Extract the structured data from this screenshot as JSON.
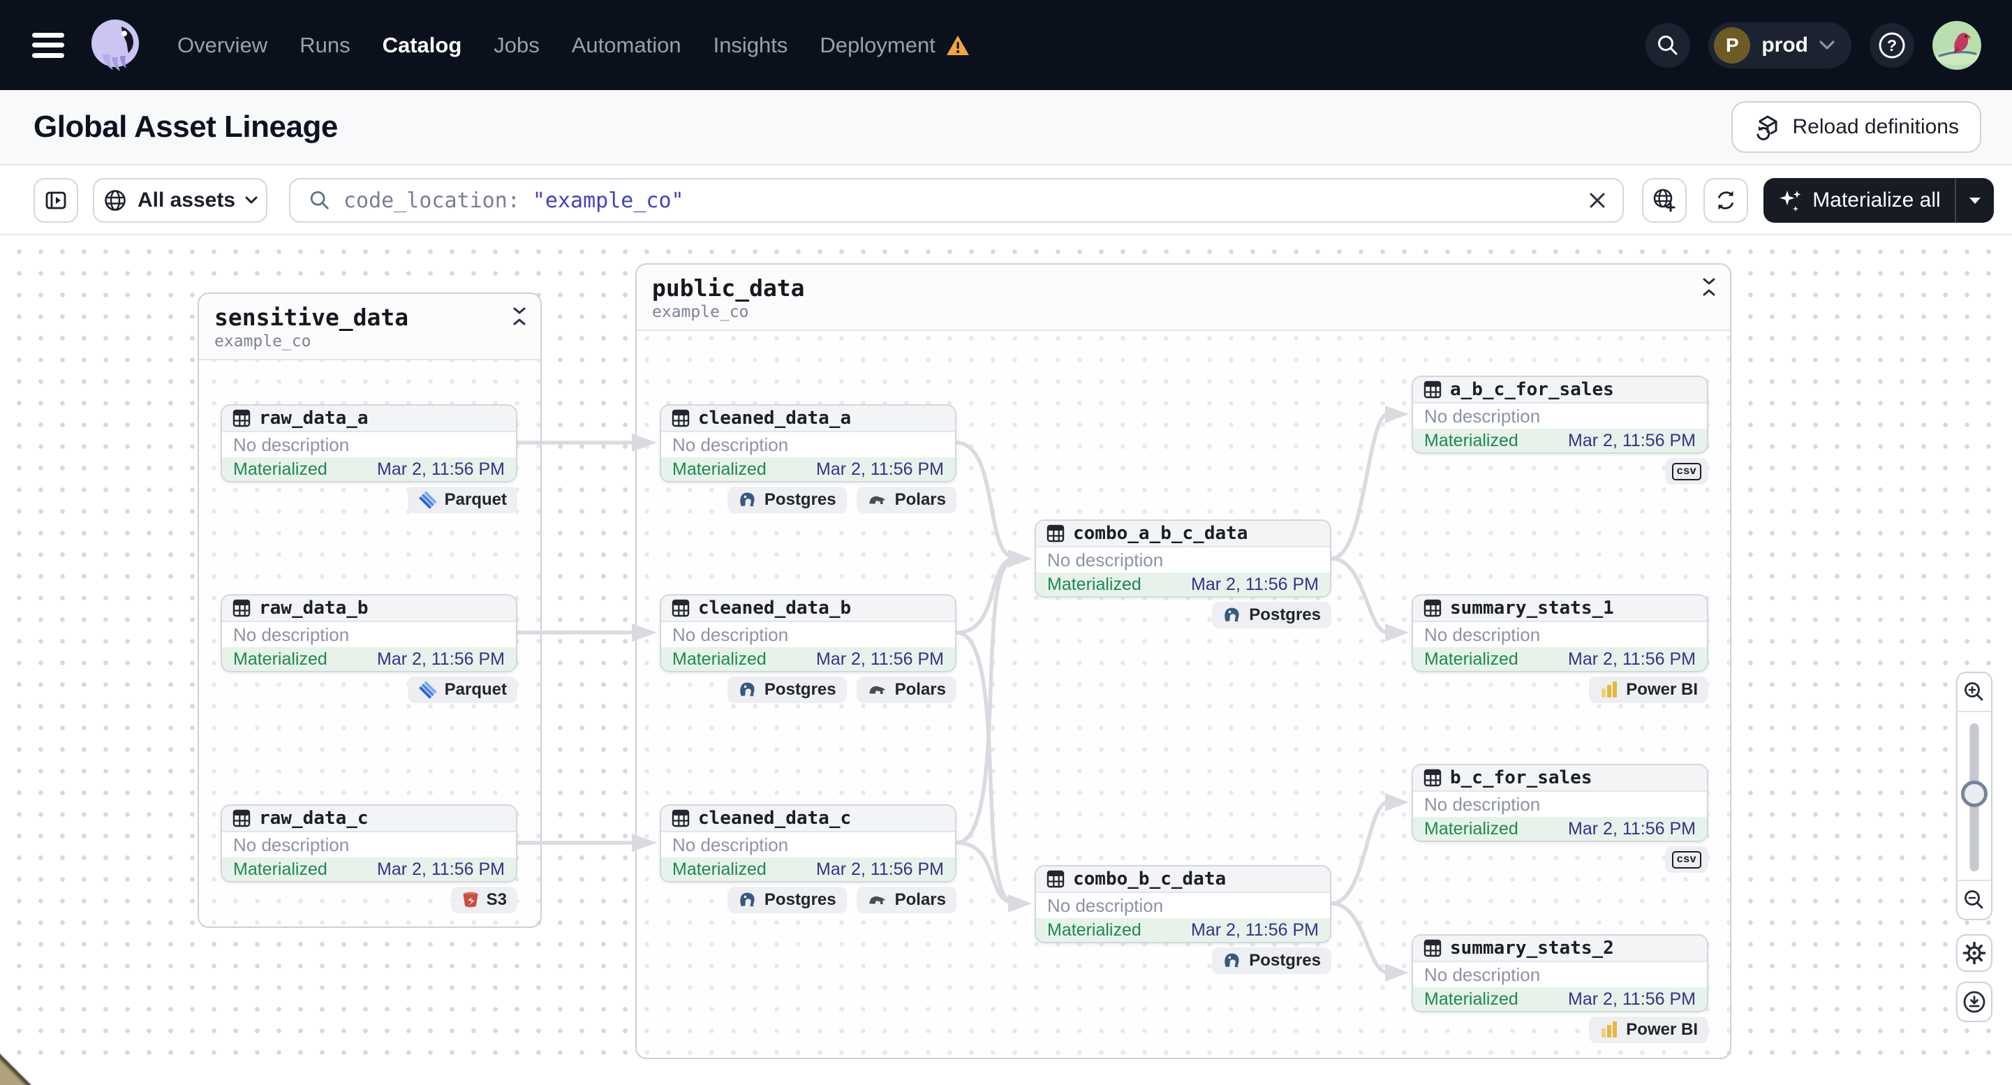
{
  "nav": {
    "items": [
      "Overview",
      "Runs",
      "Catalog",
      "Jobs",
      "Automation",
      "Insights",
      "Deployment"
    ],
    "active": "Catalog",
    "environment": {
      "initial": "P",
      "name": "prod"
    }
  },
  "header": {
    "title": "Global Asset Lineage",
    "reload_label": "Reload definitions"
  },
  "toolbar": {
    "scope_label": "All assets",
    "search_prefix": "code_location:",
    "search_value": "\"example_co\"",
    "materialize_label": "Materialize all"
  },
  "groups": [
    {
      "name": "sensitive_data",
      "location": "example_co"
    },
    {
      "name": "public_data",
      "location": "example_co"
    }
  ],
  "nodes": [
    {
      "name": "raw_data_a",
      "description": "No description",
      "status": "Materialized",
      "materialized_at": "Mar 2, 11:56 PM",
      "tags": [
        "Parquet"
      ]
    },
    {
      "name": "raw_data_b",
      "description": "No description",
      "status": "Materialized",
      "materialized_at": "Mar 2, 11:56 PM",
      "tags": [
        "Parquet"
      ]
    },
    {
      "name": "raw_data_c",
      "description": "No description",
      "status": "Materialized",
      "materialized_at": "Mar 2, 11:56 PM",
      "tags": [
        "S3"
      ]
    },
    {
      "name": "cleaned_data_a",
      "description": "No description",
      "status": "Materialized",
      "materialized_at": "Mar 2, 11:56 PM",
      "tags": [
        "Postgres",
        "Polars"
      ]
    },
    {
      "name": "cleaned_data_b",
      "description": "No description",
      "status": "Materialized",
      "materialized_at": "Mar 2, 11:56 PM",
      "tags": [
        "Postgres",
        "Polars"
      ]
    },
    {
      "name": "cleaned_data_c",
      "description": "No description",
      "status": "Materialized",
      "materialized_at": "Mar 2, 11:56 PM",
      "tags": [
        "Postgres",
        "Polars"
      ]
    },
    {
      "name": "combo_a_b_c_data",
      "description": "No description",
      "status": "Materialized",
      "materialized_at": "Mar 2, 11:56 PM",
      "tags": [
        "Postgres"
      ]
    },
    {
      "name": "combo_b_c_data",
      "description": "No description",
      "status": "Materialized",
      "materialized_at": "Mar 2, 11:56 PM",
      "tags": [
        "Postgres"
      ]
    },
    {
      "name": "a_b_c_for_sales",
      "description": "No description",
      "status": "Materialized",
      "materialized_at": "Mar 2, 11:56 PM",
      "tags": [
        "csv"
      ]
    },
    {
      "name": "summary_stats_1",
      "description": "No description",
      "status": "Materialized",
      "materialized_at": "Mar 2, 11:56 PM",
      "tags": [
        "Power BI"
      ]
    },
    {
      "name": "b_c_for_sales",
      "description": "No description",
      "status": "Materialized",
      "materialized_at": "Mar 2, 11:56 PM",
      "tags": [
        "csv"
      ]
    },
    {
      "name": "summary_stats_2",
      "description": "No description",
      "status": "Materialized",
      "materialized_at": "Mar 2, 11:56 PM",
      "tags": [
        "Power BI"
      ]
    }
  ],
  "colors": {
    "nav_bg": "#0b101d",
    "accent_query": "#4540c0",
    "status_green": "#1c8a50",
    "timestamp_blue": "#35318f",
    "warning_orange": "#f0a53e"
  }
}
